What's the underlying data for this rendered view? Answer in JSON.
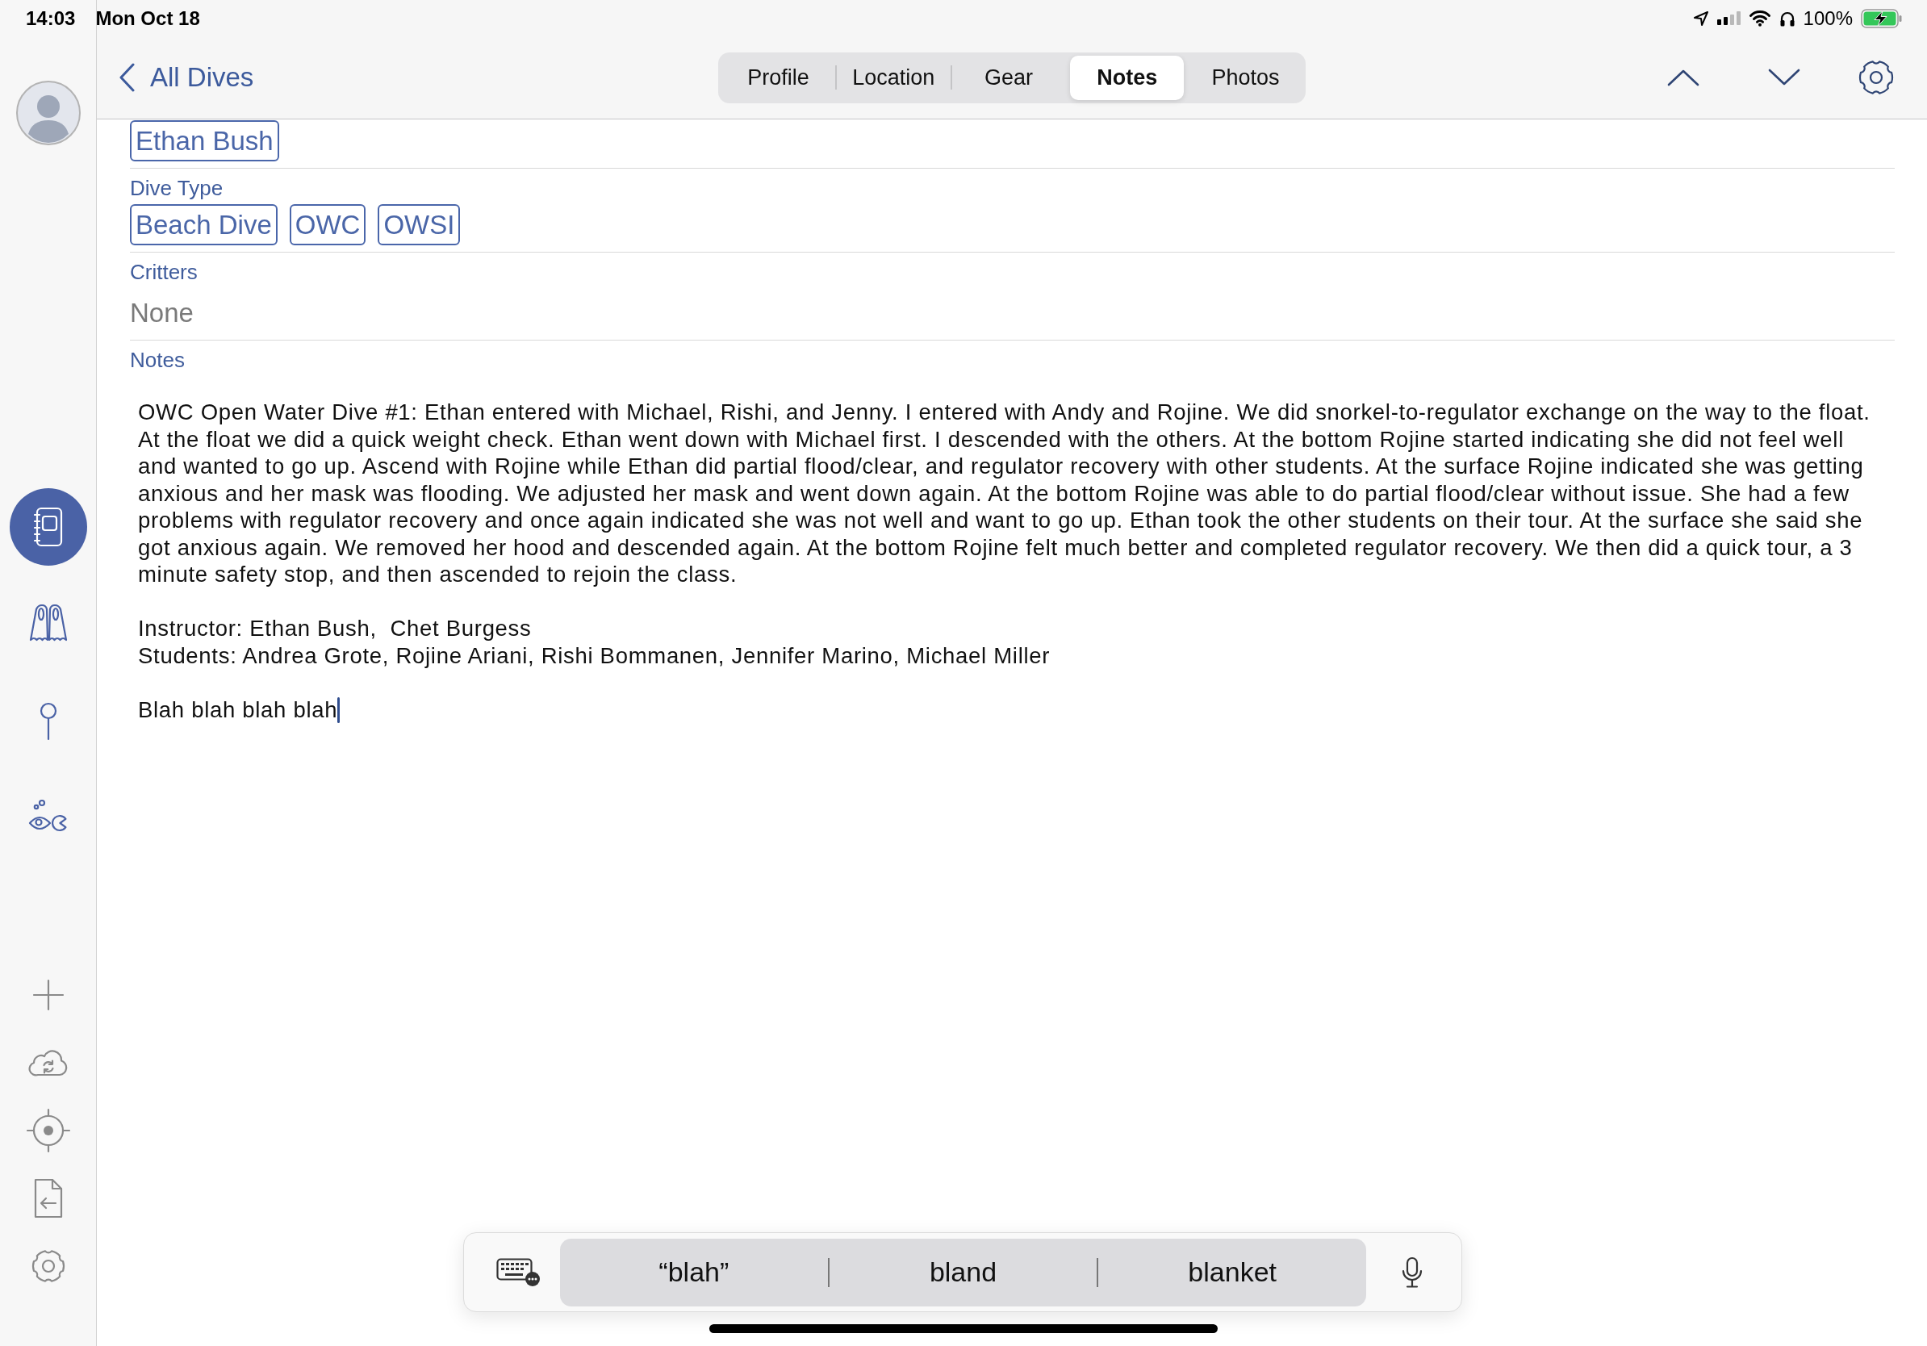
{
  "status_bar": {
    "time": "14:03",
    "date": "Mon Oct 18",
    "battery": "100%",
    "charging": true
  },
  "nav": {
    "back": "All Dives",
    "tabs": [
      {
        "label": "Profile",
        "selected": false
      },
      {
        "label": "Location",
        "selected": false
      },
      {
        "label": "Gear",
        "selected": false
      },
      {
        "label": "Notes",
        "selected": true
      },
      {
        "label": "Photos",
        "selected": false
      }
    ]
  },
  "sidebar": {
    "items": [
      {
        "kind": "logbook",
        "selected": true
      },
      {
        "kind": "fins",
        "selected": false
      },
      {
        "kind": "site",
        "selected": false
      },
      {
        "kind": "critters",
        "selected": false
      }
    ],
    "tools": [
      {
        "kind": "add"
      },
      {
        "kind": "sync"
      },
      {
        "kind": "locate"
      },
      {
        "kind": "import"
      },
      {
        "kind": "settings"
      }
    ]
  },
  "sections": [
    {
      "kind": "tags",
      "tags": [
        "Ethan Bush"
      ]
    },
    {
      "kind": "tags",
      "label": "Dive Type",
      "tags": [
        "Beach Dive",
        "OWC",
        "OWSI"
      ]
    },
    {
      "kind": "text",
      "label": "Critters",
      "value": "None"
    },
    {
      "kind": "notes",
      "label": "Notes",
      "focused": true,
      "paragraphs": [
        [
          "OWC Open Water Dive #1: Ethan entered with Michael, Rishi, and Jenny. I entered with Andy and Rojine. We did snorkel-to-regulator exchange on the way to the float. At the float we did a quick weight check. Ethan went down with Michael first. I descended with the others. At the bottom Rojine started indicating she did not feel well and wanted to go up. Ascend with Rojine while Ethan did partial flood/clear, and regulator recovery with other students. At the surface Rojine indicated she was getting anxious and her mask was flooding. We adjusted her mask and went down again. At the bottom Rojine was able to do partial flood/clear without issue. She had a few problems with regulator recovery and once again indicated she was not well and want to go up. Ethan took the other students on their tour. At the surface she said she got anxious again. We removed her hood and descended again. At the bottom Rojine felt much better and completed regulator recovery. We then did a quick tour, a 3 minute safety stop, and then ascended to rejoin the class."
        ],
        [
          "Instructor: Ethan Bush,  Chet Burgess",
          "Students: Andrea Grote, Rojine Ariani, Rishi Bommanen, Jennifer Marino, Michael Miller"
        ],
        [
          "Blah blah blah blah"
        ]
      ]
    }
  ],
  "keyboard_bar": {
    "suggestions": [
      "“blah”",
      "bland",
      "blanket"
    ]
  }
}
